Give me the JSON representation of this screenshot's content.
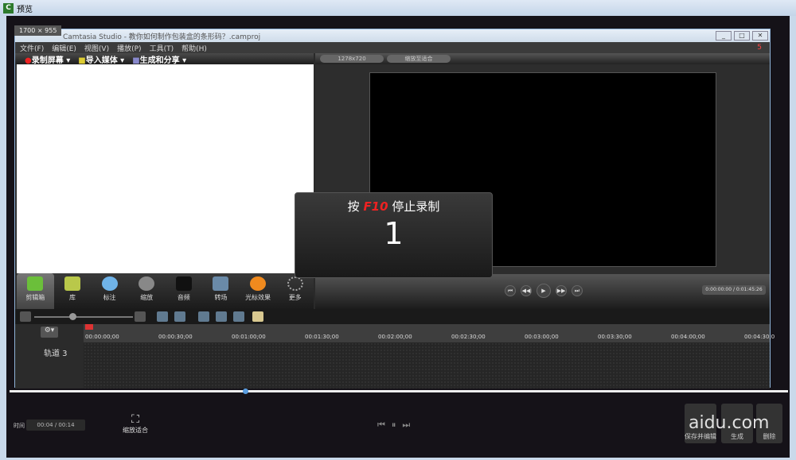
{
  "outer": {
    "title": "预览",
    "size_tip": "1700 × 955"
  },
  "app": {
    "title": "Camtasia Studio - 教你如何制作包装盒的条形码？.camproj",
    "win_buttons": [
      "_",
      "□",
      "✕"
    ]
  },
  "menu": [
    "文件(F)",
    "编辑(E)",
    "视图(V)",
    "播放(P)",
    "工具(T)",
    "帮助(H)"
  ],
  "toolbar": {
    "record": "录制屏幕 ▾",
    "import": "导入媒体 ▾",
    "produce": "生成和分享 ▾"
  },
  "preview": {
    "resolution": "1278x720",
    "zoom": "缩放至适合",
    "badge": "5"
  },
  "tabs": [
    {
      "label": "剪辑箱",
      "color": "#6bbf3a"
    },
    {
      "label": "库",
      "color": "#b9c84a"
    },
    {
      "label": "标注",
      "color": "#6fb3e8"
    },
    {
      "label": "缩放",
      "color": "#888"
    },
    {
      "label": "音频",
      "color": "#222"
    },
    {
      "label": "转场",
      "color": "#6a8aa8"
    },
    {
      "label": "光标效果",
      "color": "#f08a1e"
    },
    {
      "label": "更多",
      "color": "#555"
    }
  ],
  "player": {
    "timecode": "0:00:00:00 / 0:01:45:26"
  },
  "timeline": {
    "ticks": [
      "00:00:00;00",
      "00:00:30;00",
      "00:01:00;00",
      "00:01:30;00",
      "00:02:00;00",
      "00:02:30;00",
      "00:03:00;00",
      "00:03:30;00",
      "00:04:00;00",
      "00:04:30;0"
    ],
    "track": "轨道 3"
  },
  "overlay": {
    "prefix": "按",
    "key": "F10",
    "suffix": "停止录制",
    "count": "1"
  },
  "bottom": {
    "time_label": "时间",
    "time_value": "00:04 / 00:14",
    "fit_label": "缩放适合",
    "buttons": [
      "保存并编辑",
      "生成",
      "删除"
    ],
    "watermark": "aidu.com"
  }
}
